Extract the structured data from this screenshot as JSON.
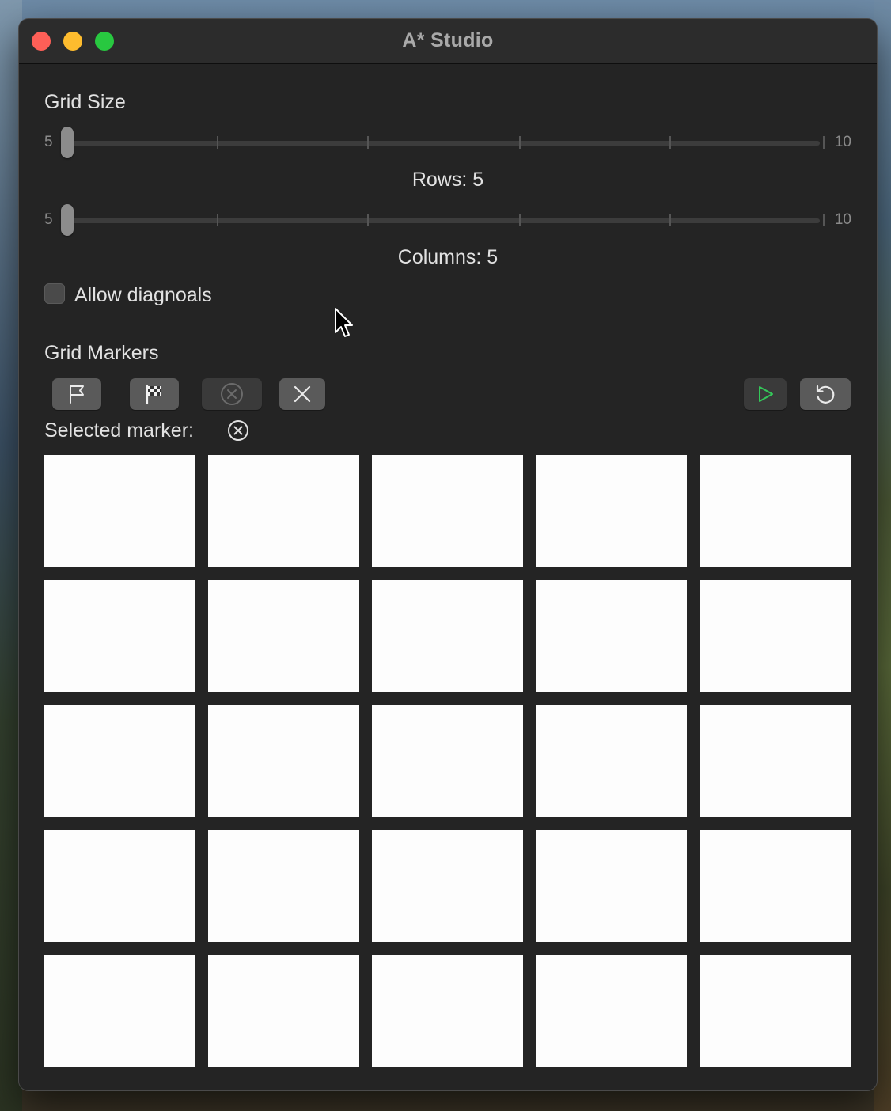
{
  "window": {
    "title": "A* Studio"
  },
  "grid_size": {
    "heading": "Grid Size",
    "rows_slider": {
      "min_label": "5",
      "max_label": "10",
      "value": 5,
      "caption": "Rows: 5"
    },
    "columns_slider": {
      "min_label": "5",
      "max_label": "10",
      "value": 5,
      "caption": "Columns: 5"
    }
  },
  "options": {
    "allow_diagonals_label": "Allow diagnoals",
    "allow_diagonals_checked": false
  },
  "markers": {
    "heading": "Grid Markers",
    "tools": [
      {
        "icon": "flag-icon",
        "role": "start"
      },
      {
        "icon": "checkered-flag-icon",
        "role": "finish"
      },
      {
        "icon": "circle-x-icon",
        "role": "obstacle",
        "selected": true
      },
      {
        "icon": "x-icon",
        "role": "clear"
      }
    ],
    "actions": [
      {
        "icon": "play-icon",
        "role": "run",
        "color": "#34c759"
      },
      {
        "icon": "reset-icon",
        "role": "reset"
      }
    ],
    "selected_label": "Selected marker:",
    "selected_icon": "circle-x-icon"
  },
  "grid": {
    "rows": 5,
    "columns": 5,
    "cell_color": "#fdfdfd"
  }
}
